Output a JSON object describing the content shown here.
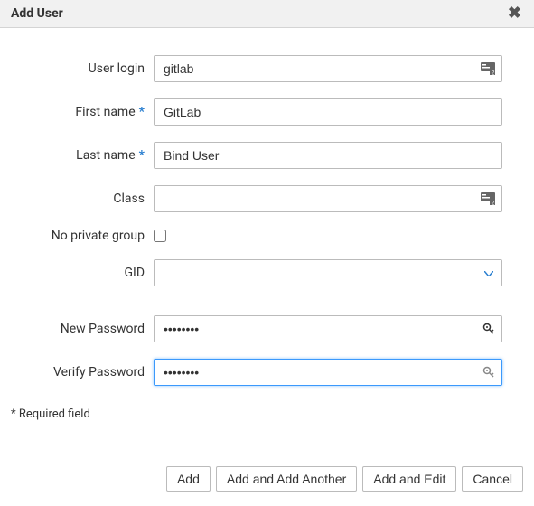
{
  "dialog": {
    "title": "Add User"
  },
  "form": {
    "user_login": {
      "label": "User login",
      "value": "gitlab"
    },
    "first_name": {
      "label": "First name",
      "value": "GitLab",
      "required": true
    },
    "last_name": {
      "label": "Last name",
      "value": "Bind User",
      "required": true
    },
    "class": {
      "label": "Class",
      "value": ""
    },
    "no_private_group": {
      "label": "No private group",
      "checked": false
    },
    "gid": {
      "label": "GID",
      "value": ""
    },
    "new_password": {
      "label": "New Password",
      "value": "••••••••"
    },
    "verify_password": {
      "label": "Verify Password",
      "value": "••••••••"
    }
  },
  "footnote": "* Required field",
  "buttons": {
    "add": "Add",
    "add_another": "Add and Add Another",
    "add_edit": "Add and Edit",
    "cancel": "Cancel"
  }
}
